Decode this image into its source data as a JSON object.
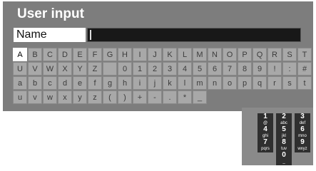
{
  "dialog": {
    "title": "User input",
    "name_label": "Name",
    "name_value": ""
  },
  "keyboard": {
    "selected": "A",
    "rows": [
      [
        "A",
        "B",
        "C",
        "D",
        "E",
        "F",
        "G",
        "H",
        "I",
        "J",
        "K",
        "L",
        "M",
        "N",
        "O",
        "P",
        "Q",
        "R",
        "S",
        "T"
      ],
      [
        "U",
        "V",
        "W",
        "X",
        "Y",
        "Z",
        "",
        "0",
        "1",
        "2",
        "3",
        "4",
        "5",
        "6",
        "7",
        "8",
        "9",
        "!",
        ":",
        "#"
      ],
      [
        "a",
        "b",
        "c",
        "d",
        "e",
        "f",
        "g",
        "h",
        "i",
        "j",
        "k",
        "l",
        "m",
        "n",
        "o",
        "p",
        "q",
        "r",
        "s",
        "t"
      ],
      [
        "u",
        "v",
        "w",
        "x",
        "y",
        "z",
        "(",
        ")",
        "+",
        "-",
        ".",
        "*",
        "_"
      ]
    ]
  },
  "numpad": {
    "keys": [
      {
        "digit": "1",
        "letters": "@"
      },
      {
        "digit": "2",
        "letters": "abc"
      },
      {
        "digit": "3",
        "letters": "def"
      },
      {
        "digit": "4",
        "letters": "ghi"
      },
      {
        "digit": "5",
        "letters": "jkl"
      },
      {
        "digit": "6",
        "letters": "mno"
      },
      {
        "digit": "7",
        "letters": "pqrs"
      },
      {
        "digit": "8",
        "letters": "tuv"
      },
      {
        "digit": "9",
        "letters": "wxyz"
      },
      {
        "digit": "0",
        "letters": "_"
      }
    ]
  }
}
